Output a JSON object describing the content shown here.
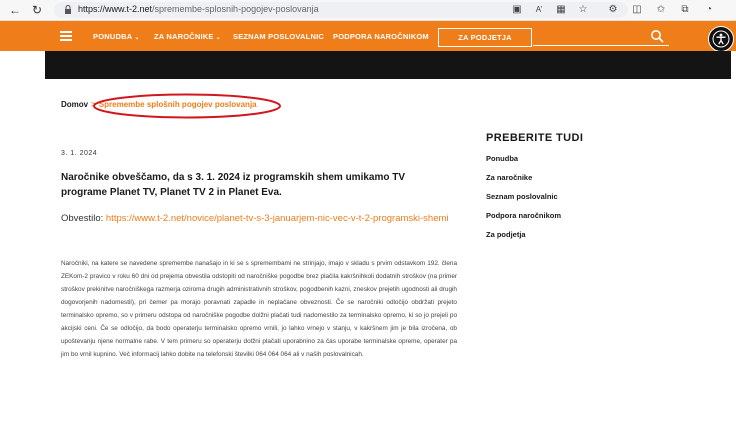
{
  "browser": {
    "url_host": "https://www.t-2.net",
    "url_path": "/spremembe-splosnih-pogojev-poslovanja",
    "reader_label": "A’"
  },
  "header": {
    "menu": [
      {
        "label": "PONUDBA",
        "has_caret": true
      },
      {
        "label": "ZA NAROČNIKE",
        "has_caret": true
      },
      {
        "label": "SEZNAM POSLOVALNIC",
        "has_caret": false
      },
      {
        "label": "PODPORA NAROČNIKOM",
        "has_caret": false
      }
    ],
    "caret": "⌄",
    "business_button": "ZA PODJETJA"
  },
  "breadcrumb": {
    "home": "Domov",
    "separator": ">",
    "current": "Spremembe splošnih pogojev poslovanja"
  },
  "article": {
    "date": "3. 1. 2024",
    "title": "Naročnike obveščamo, da s 3. 1. 2024 iz programskih shem umikamo TV programe Planet TV, Planet TV 2 in Planet Eva.",
    "notice_label": "Obvestilo:",
    "notice_link": "https://www.t-2.net/novice/planet-tv-s-3-januarjem-nic-vec-v-t-2-programski-shemi",
    "body": "Naročniki, na katere se navedene spremembe nanašajo in ki se s spremembami ne strinjajo, imajo v skladu s prvim odstavkom 192. člena ZEKom-2 pravico v roku 60 dni od prejema obvestila odstopiti od naročniške pogodbe brez plačila kakršnihkoli dodatnih stroškov (na primer stroškov prekinitve naročniškega razmerja oziroma drugih administrativnih stroškov, pogodbenih kazni, zneskov prejetih ugodnosti ali drugih dogovorjenih nadomestil), pri čemer pa morajo poravnati zapadle in neplačane obveznosti. Če se naročniki odločijo obdržati prejeto terminalsko opremo, so v primeru odstopa od naročniške pogodbe dolžni plačati tudi nadomestilo za terminalsko opremo, ki so jo prejeli po akcijski ceni. Če se odločijo, da bodo operaterju terminalsko opremo vrnili, jo lahko vrnejo v stanju, v kakršnem jim je bila izročena, ob upoštevanju njene normalne rabe. V tem primeru so operaterju dolžni plačati uporabnino za čas uporabe terminalske opreme, operater pa jim bo vrnil kupnino. Več informacij lahko dobite na telefonski številki 064 064 064 ali v naših poslovalnicah."
  },
  "sidebar": {
    "title": "PREBERITE TUDI",
    "links": [
      "Ponudba",
      "Za naročnike",
      "Seznam poslovalnic",
      "Podpora naročnikom",
      "Za podjetja"
    ]
  },
  "colors": {
    "brand_orange": "#ef7d1a",
    "highlight_red": "#d0161f",
    "dark_band": "#141414"
  }
}
